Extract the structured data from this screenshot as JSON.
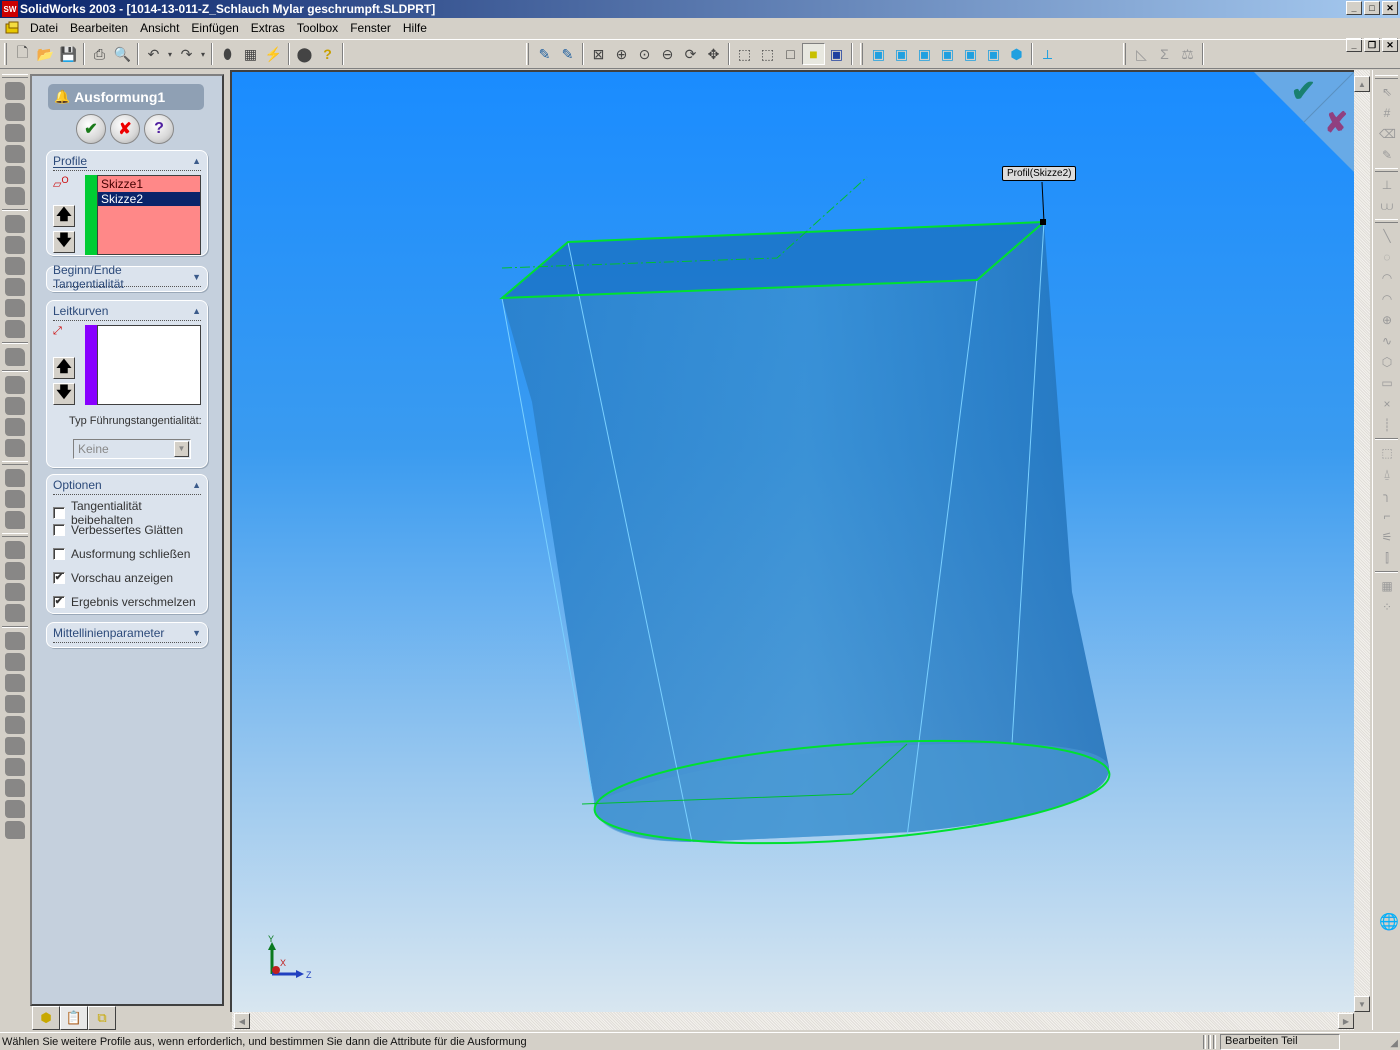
{
  "window": {
    "app_icon": "SW",
    "title": "SolidWorks 2003 - [1014-13-011-Z_Schlauch Mylar geschrumpft.SLDPRT]",
    "controls": [
      "minimize",
      "maximize",
      "close"
    ]
  },
  "menubar": {
    "items": [
      "Datei",
      "Bearbeiten",
      "Ansicht",
      "Einfügen",
      "Extras",
      "Toolbox",
      "Fenster",
      "Hilfe"
    ]
  },
  "toolbar": {
    "standard": [
      "new-icon",
      "open-icon",
      "save-icon",
      "print-icon",
      "print-preview-icon",
      "undo-icon",
      "redo-icon",
      "rebuild-icon",
      "grid-icon",
      "filter-icon",
      "macro-icon",
      "help-icon"
    ],
    "view": [
      "zoom-fit-icon",
      "zoom-in-icon",
      "zoom-area-icon",
      "zoom-out-icon",
      "rotate-icon",
      "pan-icon",
      "wireframe-icon",
      "hidden-lines-visible-icon",
      "hidden-lines-removed-icon",
      "shaded-icon",
      "shadows-icon"
    ],
    "standard_views": [
      "front-icon",
      "back-icon",
      "left-icon",
      "right-icon",
      "top-icon",
      "bottom-icon",
      "isometric-icon",
      "normal-to-icon"
    ],
    "tools": [
      "measure-icon",
      "mass-properties-icon",
      "section-icon"
    ],
    "active": "shaded-icon"
  },
  "property_manager": {
    "feature_title": "Ausformung1",
    "ok_label": "✔",
    "cancel_label": "✘",
    "help_label": "?",
    "profile": {
      "header": "Profile",
      "items": [
        "Skizze1",
        "Skizze2"
      ],
      "selected": "Skizze2",
      "list_color": "#ff8080",
      "bar_color": "#00cc33"
    },
    "tangency": {
      "header": "Beginn/Ende Tangentialität"
    },
    "guide_curves": {
      "header": "Leitkurven",
      "items": [],
      "bar_color": "#8800ff",
      "tangency_type_label": "Typ Führungstangentialität:",
      "tangency_type_value": "Keine"
    },
    "options": {
      "header": "Optionen",
      "checkboxes": [
        {
          "label": "Tangentialität beibehalten",
          "checked": false
        },
        {
          "label": "Verbessertes Glätten",
          "checked": false
        },
        {
          "label": "Ausformung schließen",
          "checked": false
        },
        {
          "label": "Vorschau anzeigen",
          "checked": true
        },
        {
          "label": "Ergebnis verschmelzen",
          "checked": true
        }
      ]
    },
    "centerline": {
      "header": "Mittellinienparameter"
    },
    "tabs": [
      "feature-manager-tab",
      "property-manager-tab",
      "configuration-manager-tab"
    ]
  },
  "viewport": {
    "callout": "Profil(Skizze2)",
    "axes": {
      "x": "X",
      "y": "Y",
      "z": "Z"
    },
    "confirm_ok": "✔",
    "confirm_cancel": "✘"
  },
  "statusbar": {
    "message": "Wählen Sie weitere Profile aus, wenn erforderlich, und bestimmen Sie dann die Attribute für die Ausformung",
    "mode": "Bearbeiten Teil"
  }
}
